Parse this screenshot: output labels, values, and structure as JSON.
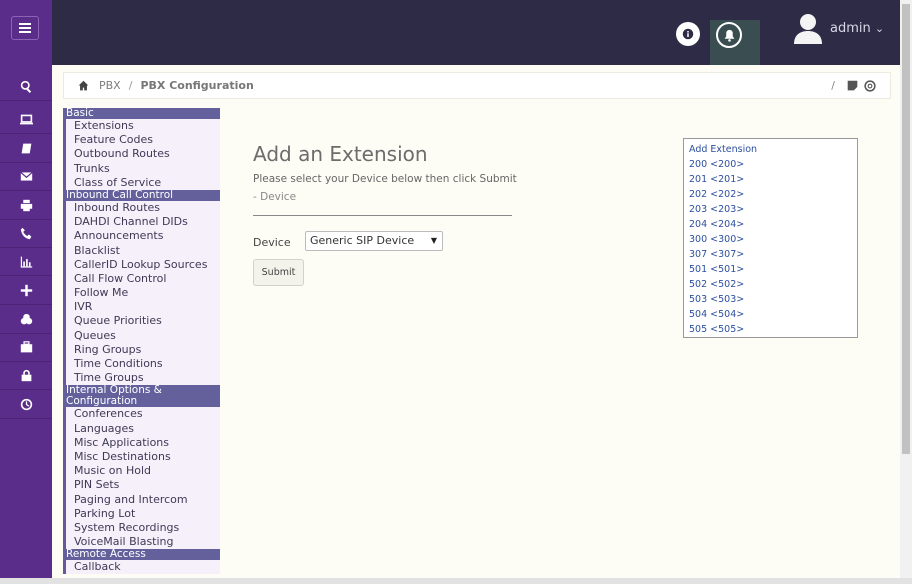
{
  "header": {
    "user": "admin",
    "user_caret": "⌄"
  },
  "breadcrumb": {
    "root": "PBX",
    "separator": "/",
    "current": "PBX Configuration",
    "right_separator": "/"
  },
  "rail_icons": [
    "search-icon",
    "monitor-icon",
    "book-icon",
    "mail-icon",
    "printer-icon",
    "phone-icon",
    "chart-icon",
    "plus-icon",
    "users-icon",
    "briefcase-icon",
    "lock-icon",
    "history-icon"
  ],
  "menu": {
    "basic": {
      "label": "Basic",
      "items": [
        "Extensions",
        "Feature Codes",
        "Outbound Routes",
        "Trunks",
        "Class of Service"
      ]
    },
    "inbound": {
      "label": "Inbound Call Control",
      "items": [
        "Inbound Routes",
        "DAHDI Channel DIDs",
        "Announcements",
        "Blacklist",
        "CallerID Lookup Sources",
        "Call Flow Control",
        "Follow Me",
        "IVR",
        "Queue Priorities",
        "Queues",
        "Ring Groups",
        "Time Conditions",
        "Time Groups"
      ]
    },
    "internal": {
      "label": "Internal Options & Configuration",
      "items": [
        "Conferences",
        "Languages",
        "Misc Applications",
        "Misc Destinations",
        "Music on Hold",
        "PIN Sets",
        "Paging and Intercom",
        "Parking Lot",
        "System Recordings",
        "VoiceMail Blasting"
      ]
    },
    "remote": {
      "label": "Remote Access",
      "items": [
        "Callback"
      ]
    }
  },
  "form": {
    "title": "Add an Extension",
    "subtitle": "Please select your Device below then click Submit",
    "section": "- Device",
    "device_label": "Device",
    "device_value": "Generic SIP Device",
    "submit_label": "Submit"
  },
  "extensions": {
    "add_label": "Add Extension",
    "items": [
      "200 <200>",
      "201 <201>",
      "202 <202>",
      "203 <203>",
      "204 <204>",
      "300 <300>",
      "307 <307>",
      "501 <501>",
      "502 <502>",
      "503 <503>",
      "504 <504>",
      "505 <505>"
    ]
  }
}
